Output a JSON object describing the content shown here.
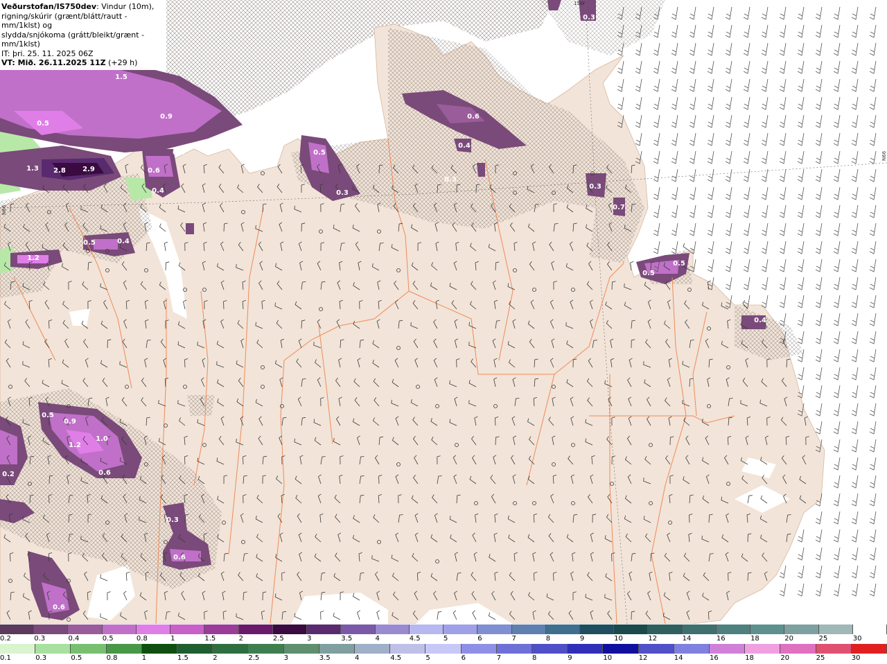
{
  "header": {
    "title_bold": "Veðurstofan/IS750dev",
    "title_rest": ": Vindur (10m),",
    "line2": "rigning/skúrir (grænt/blátt/rautt - mm/1klst) og",
    "line3": "slydda/snjókoma (grátt/bleikt/grænt - mm/1klst)",
    "it_line": "IT: þri. 25. 11. 2025 06Z",
    "vt_line": "VT: Mið. 26.11.2025 11Z",
    "vt_offset": " (+29 h)"
  },
  "map_labels": [
    {
      "text": "1.5"
    },
    {
      "text": "0.5"
    },
    {
      "text": "0.9"
    },
    {
      "text": "1.3"
    },
    {
      "text": "2.8"
    },
    {
      "text": "2.9"
    },
    {
      "text": "0.6"
    },
    {
      "text": "0.4"
    },
    {
      "text": "0.4"
    },
    {
      "text": "0.5"
    },
    {
      "text": "0.4"
    },
    {
      "text": "1.2"
    },
    {
      "text": "0.5"
    },
    {
      "text": "0.3"
    },
    {
      "text": "0.6"
    },
    {
      "text": "0.4"
    },
    {
      "text": "0.3"
    },
    {
      "text": "0.3"
    },
    {
      "text": "0.7"
    },
    {
      "text": "0.5"
    },
    {
      "text": "0.5"
    },
    {
      "text": "0.4"
    },
    {
      "text": "0.5"
    },
    {
      "text": "0.9"
    },
    {
      "text": "1.2"
    },
    {
      "text": "1.0"
    },
    {
      "text": "0.6"
    },
    {
      "text": "0.2"
    },
    {
      "text": "0.3"
    },
    {
      "text": "0.6"
    },
    {
      "text": "0.6"
    },
    {
      "text": "0.3"
    }
  ],
  "edge_labels": {
    "left": "N66",
    "right": "N66",
    "top": "15W"
  },
  "legend_snow": {
    "ticks": [
      "0.2",
      "0.3",
      "0.4",
      "0.5",
      "0.8",
      "1",
      "1.5",
      "2",
      "2.5",
      "3",
      "3.5",
      "4",
      "4.5",
      "5",
      "6",
      "7",
      "8",
      "9",
      "10",
      "12",
      "14",
      "16",
      "18",
      "20",
      "25",
      "30"
    ],
    "colors": [
      "#5b3a5c",
      "#7a4a7a",
      "#9a5c9a",
      "#c070c8",
      "#e07ee8",
      "#c860c8",
      "#9a3c98",
      "#6a1a6a",
      "#3a0a40",
      "#5a2a70",
      "#7a5aa8",
      "#9a8ad0",
      "#b8b8f0",
      "#a0a0e8",
      "#7f8fd0",
      "#5f7fb0",
      "#3f6f8f",
      "#1f4f5f",
      "#1a4a4a",
      "#2f5f5f",
      "#3f7070",
      "#4f8080",
      "#5f9090",
      "#7fa0a0",
      "#a0b8b8",
      "#ffffff"
    ]
  },
  "legend_rain": {
    "ticks": [
      "0.1",
      "0.3",
      "0.5",
      "0.8",
      "1",
      "1.5",
      "2",
      "2.5",
      "3",
      "3.5",
      "4",
      "4.5",
      "5",
      "6",
      "7",
      "8",
      "9",
      "10",
      "12",
      "14",
      "16",
      "18",
      "20",
      "25",
      "30"
    ],
    "colors": [
      "#d8f5d0",
      "#a8e0a0",
      "#78c070",
      "#489848",
      "#0f4f0f",
      "#1f5f2f",
      "#2f6f3f",
      "#3f7f4f",
      "#5f8f6f",
      "#7f9fa0",
      "#9fb0c8",
      "#bfc0e8",
      "#c8c8f8",
      "#8f8fe8",
      "#6f6fd8",
      "#4f4fc8",
      "#2f2fb8",
      "#1010a0",
      "#5050c8",
      "#8080e0",
      "#d080d8",
      "#f0a0e0",
      "#e070c0",
      "#e05070",
      "#e02020"
    ]
  }
}
